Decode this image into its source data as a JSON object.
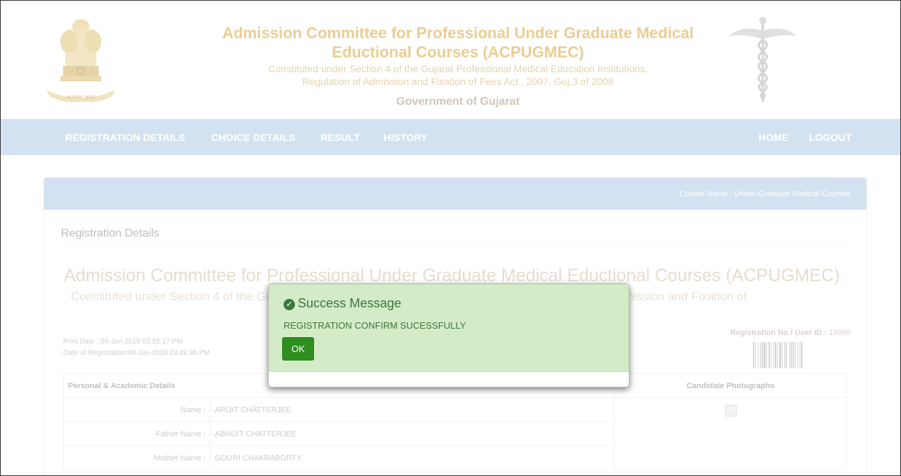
{
  "header": {
    "title_line1": "Admission Committee for Professional Under Graduate Medical",
    "title_line2": "Eductional Courses (ACPUGMEC)",
    "subtitle_line1": "Constituted under Section 4 of the Gujarat Professional Medical Education Institutions,",
    "subtitle_line2": "Regulation of Admission and Fixation of Fees Act., 2007, Guj.3 of 2008",
    "government": "Government of Gujarat",
    "emblem_motto": "सत्यमेव जयते",
    "left_logo_icon": "ashoka-emblem-icon",
    "right_logo_icon": "caduceus-icon"
  },
  "nav": {
    "items": [
      "REGISTRATION DETAILS",
      "CHOICE DETAILS",
      "RESULT",
      "HISTORY"
    ],
    "right_items": [
      "HOME",
      "LOGOUT"
    ]
  },
  "panel": {
    "course_name": "Course Name : Under-Graduate Medical Courses",
    "section_title": "Registration Details",
    "big_title": "Admission Committee for Professional Under Graduate Medical Eductional Courses (ACPUGMEC)",
    "big_sub": "Constituted under Section 4 of the Gujarat Professional Medical Education Institutions, Regulation of Admission and Fixation of",
    "print_date": "Print Date : 08-Jun-2018 03:55:17 PM",
    "reg_date": "Date of Registration:08-Jun-2018 03:48:36 PM",
    "regno_label": "Registration No / User ID :",
    "regno_value": " 19999",
    "table": {
      "header_left": "Personal & Academic Details",
      "header_right": "Candidate Photographs",
      "rows": [
        {
          "label": "Name :",
          "value": "ARIJIT CHATTERJEE"
        },
        {
          "label": "Father Name :",
          "value": "ABHIJIT CHATTERJEE"
        },
        {
          "label": "Mother Name :",
          "value": "GOURI CHAKRABORTY"
        }
      ]
    }
  },
  "modal": {
    "title": "Success Message",
    "message": "REGISTRATION CONFIRM SUCESSFULLY",
    "ok_label": "OK",
    "accent": "#3c763d",
    "button_color": "#2e8f1e"
  }
}
